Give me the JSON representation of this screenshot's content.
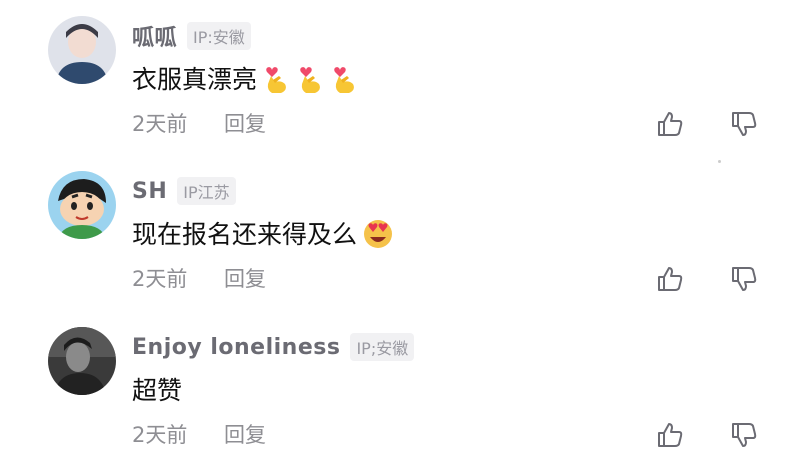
{
  "comments": [
    {
      "username": "呱呱",
      "ip": "IP:安徽",
      "content": "衣服真漂亮",
      "emojis": [
        "finger-heart-icon",
        "finger-heart-icon",
        "finger-heart-icon"
      ],
      "time": "2天前",
      "reply_label": "回复"
    },
    {
      "username": "SH",
      "ip": "IP江苏",
      "content": "现在报名还来得及么",
      "emojis": [
        "heart-eyes-emoji-icon"
      ],
      "time": "2天前",
      "reply_label": "回复"
    },
    {
      "username": "Enjoy loneliness",
      "ip": "IP;安徽",
      "content": "超赞",
      "emojis": [],
      "time": "2天前",
      "reply_label": "回复"
    }
  ],
  "colors": {
    "username": "#6b6b73",
    "meta": "#8e8e93",
    "content": "#111111",
    "ip_tag_bg": "#f1f1f3"
  }
}
